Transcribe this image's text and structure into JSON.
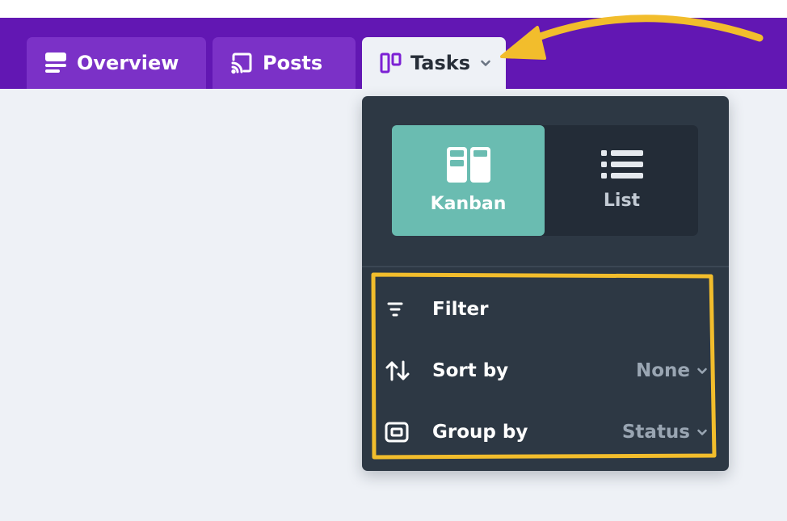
{
  "tabs": {
    "overview": {
      "label": "Overview"
    },
    "posts": {
      "label": "Posts"
    },
    "tasks": {
      "label": "Tasks"
    }
  },
  "view_toggle": {
    "kanban": {
      "label": "Kanban",
      "active": true
    },
    "list": {
      "label": "List",
      "active": false
    }
  },
  "menu": {
    "filter": {
      "label": "Filter"
    },
    "sort": {
      "label": "Sort by",
      "value": "None"
    },
    "group": {
      "label": "Group by",
      "value": "Status"
    }
  },
  "colors": {
    "navbar": "#6217b3",
    "tab": "#7b31c7",
    "dropdown": "#2d3844",
    "kanban_active": "#6abcb1",
    "annotation": "#f2bd2c"
  },
  "icons": {
    "overview": "overview-list-icon",
    "posts": "rss-feed-icon",
    "tasks": "kanban-columns-icon",
    "filter": "filter-lines-icon",
    "sort": "sort-arrows-icon",
    "group": "group-box-icon"
  }
}
